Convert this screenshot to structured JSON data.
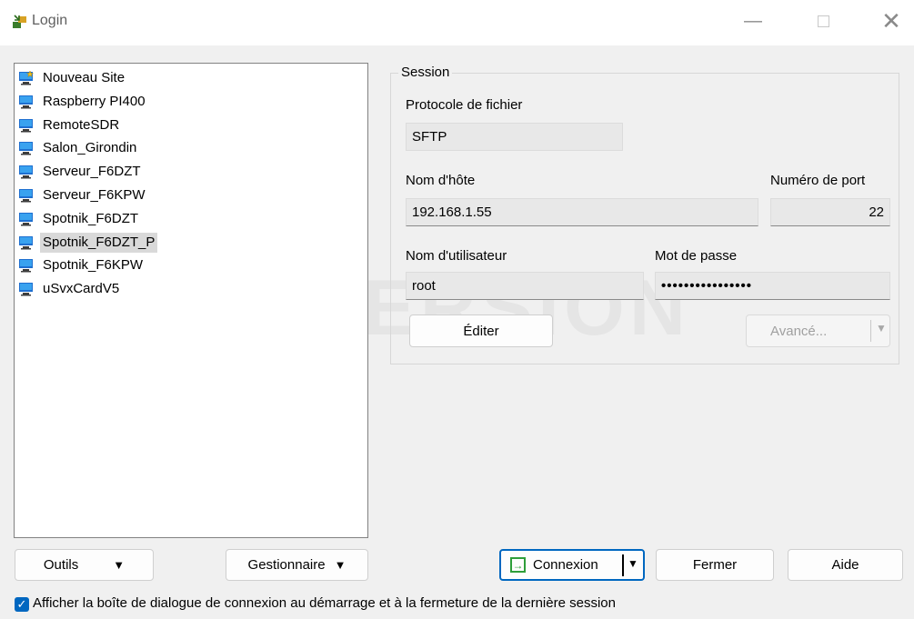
{
  "window": {
    "title": "Login",
    "controls": {
      "minimize": "—",
      "close": "✕"
    }
  },
  "sites": [
    {
      "label": "Nouveau Site",
      "icon": "new-site-icon",
      "selected": false
    },
    {
      "label": "Raspberry PI400",
      "icon": "computer-icon",
      "selected": false
    },
    {
      "label": "RemoteSDR",
      "icon": "computer-icon",
      "selected": false
    },
    {
      "label": "Salon_Girondin",
      "icon": "computer-icon",
      "selected": false
    },
    {
      "label": "Serveur_F6DZT",
      "icon": "computer-icon",
      "selected": false
    },
    {
      "label": "Serveur_F6KPW",
      "icon": "computer-icon",
      "selected": false
    },
    {
      "label": "Spotnik_F6DZT",
      "icon": "computer-icon",
      "selected": false
    },
    {
      "label": "Spotnik_F6DZT_P",
      "icon": "computer-icon",
      "selected": true
    },
    {
      "label": "Spotnik_F6KPW",
      "icon": "computer-icon",
      "selected": false
    },
    {
      "label": "uSvxCardV5",
      "icon": "computer-icon",
      "selected": false
    }
  ],
  "watermark": "DEMO VERSION",
  "session": {
    "group_title": "Session",
    "protocol_label": "Protocole de fichier",
    "protocol_value": "SFTP",
    "host_label": "Nom d'hôte",
    "host_value": "192.168.1.55",
    "port_label": "Numéro de port",
    "port_value": "22",
    "user_label": "Nom d'utilisateur",
    "user_value": "root",
    "password_label": "Mot de passe",
    "password_value": "••••••••••••••••",
    "edit_button": "Éditer",
    "advanced_button": "Avancé..."
  },
  "bottom": {
    "tools_button": "Outils",
    "manager_button": "Gestionnaire",
    "connect_button": "Connexion",
    "close_button": "Fermer",
    "help_button": "Aide"
  },
  "startup_checkbox": {
    "checked": true,
    "label": "Afficher la boîte de dialogue de connexion au démarrage et à la fermeture de la dernière session"
  },
  "colors": {
    "accent": "#0067c0",
    "selection": "#d9d9d9",
    "connect_icon": "#2e9e3a"
  }
}
